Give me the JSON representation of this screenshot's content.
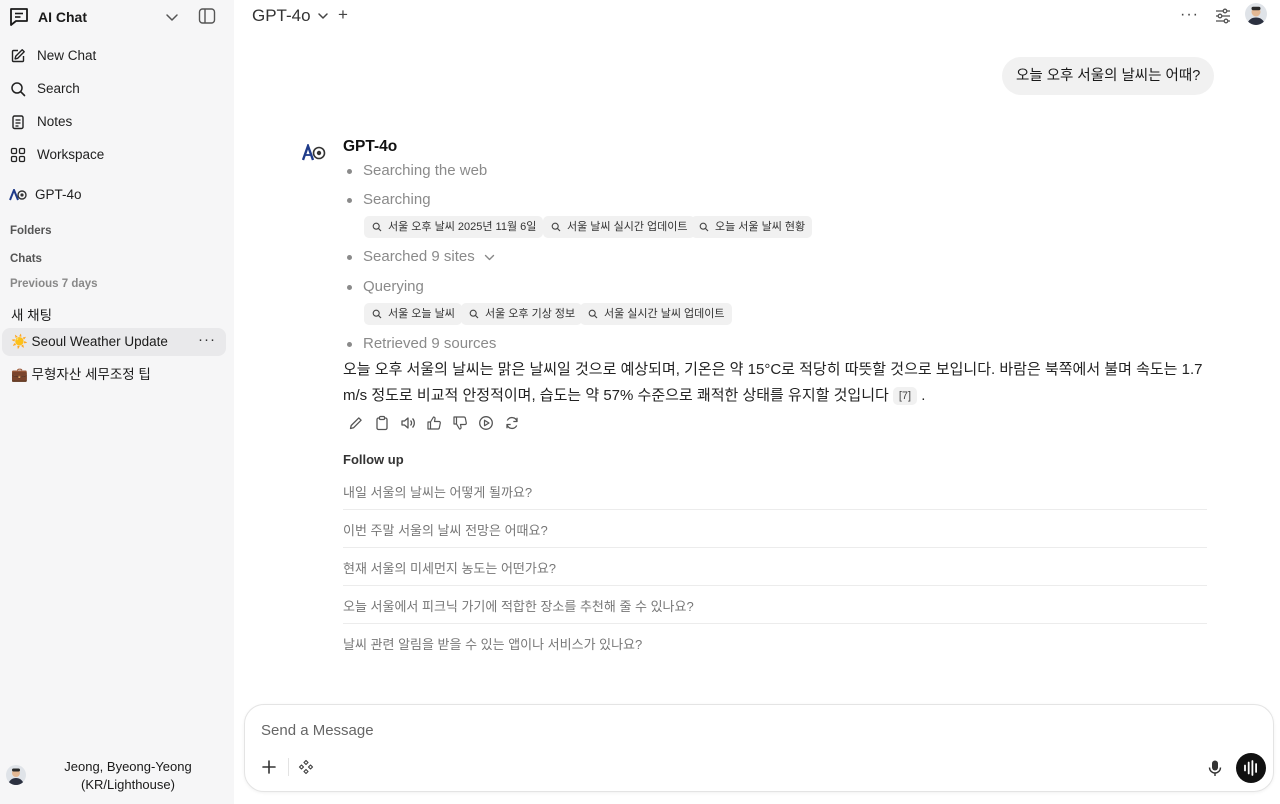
{
  "sidebar": {
    "app_title": "AI Chat",
    "nav": {
      "new_chat": "New Chat",
      "search": "Search",
      "notes": "Notes",
      "workspace": "Workspace"
    },
    "model": "GPT-4o",
    "folders_label": "Folders",
    "chats_label": "Chats",
    "group_label": "Previous 7 days",
    "chats": [
      {
        "label": "새 채팅"
      },
      {
        "label": "☀️ Seoul Weather Update",
        "active": true
      },
      {
        "label": "💼 무형자산 세무조정 팁"
      }
    ],
    "chat_more": "···",
    "user_name_line1": "Jeong, Byeong-Yeong",
    "user_name_line2": "(KR/Lighthouse)"
  },
  "header": {
    "model": "GPT-4o",
    "add": "+",
    "more": "···"
  },
  "conversation": {
    "user_message": "오늘 오후 서울의 날씨는 어때?",
    "assistant_model": "GPT-4o",
    "steps": {
      "s1": "Searching the web",
      "s2": "Searching",
      "s3": "Searched 9 sites",
      "s4": "Querying",
      "s5": "Retrieved 9 sources"
    },
    "search_chips": [
      "서울 오후 날씨 2025년 11월 6일",
      "서울 날씨 실시간 업데이트",
      "오늘 서울 날씨 현황"
    ],
    "query_chips": [
      "서울 오늘 날씨",
      "서울 오후 기상 정보",
      "서울 실시간 날씨 업데이트"
    ],
    "answer": "오늘 오후 서울의 날씨는 맑은 날씨일 것으로 예상되며, 기온은 약 15°C로 적당히 따뜻할 것으로 보입니다. 바람은 북쪽에서 불며 속도는 1.7 m/s 정도로 비교적 안정적이며, 습도는 약 57% 수준으로 쾌적한 상태를 유지할 것입니다",
    "citation": "[7]",
    "answer_end": ".",
    "follow_up_title": "Follow up",
    "follow_ups": [
      "내일 서울의 날씨는 어떻게 될까요?",
      "이번 주말 서울의 날씨 전망은 어때요?",
      "현재 서울의 미세먼지 농도는 어떤가요?",
      "오늘 서울에서 피크닉 가기에 적합한 장소를 추천해 줄 수 있나요?",
      "날씨 관련 알림을 받을 수 있는 앱이나 서비스가 있나요?"
    ]
  },
  "composer": {
    "placeholder": "Send a Message"
  },
  "icons": {
    "sidebar": [
      "chat-bubble-icon",
      "chevron-down-icon",
      "sidebar-toggle-icon",
      "edit-icon",
      "search-icon",
      "notes-icon",
      "workspace-icon",
      "model-logo-icon",
      "avatar"
    ],
    "actions": [
      "pencil-icon",
      "clipboard-icon",
      "speaker-icon",
      "thumbs-up-icon",
      "thumbs-down-icon",
      "play-icon",
      "regenerate-icon"
    ],
    "composer": [
      "plus-icon",
      "tools-icon",
      "mic-icon",
      "voice-mode-icon"
    ]
  }
}
